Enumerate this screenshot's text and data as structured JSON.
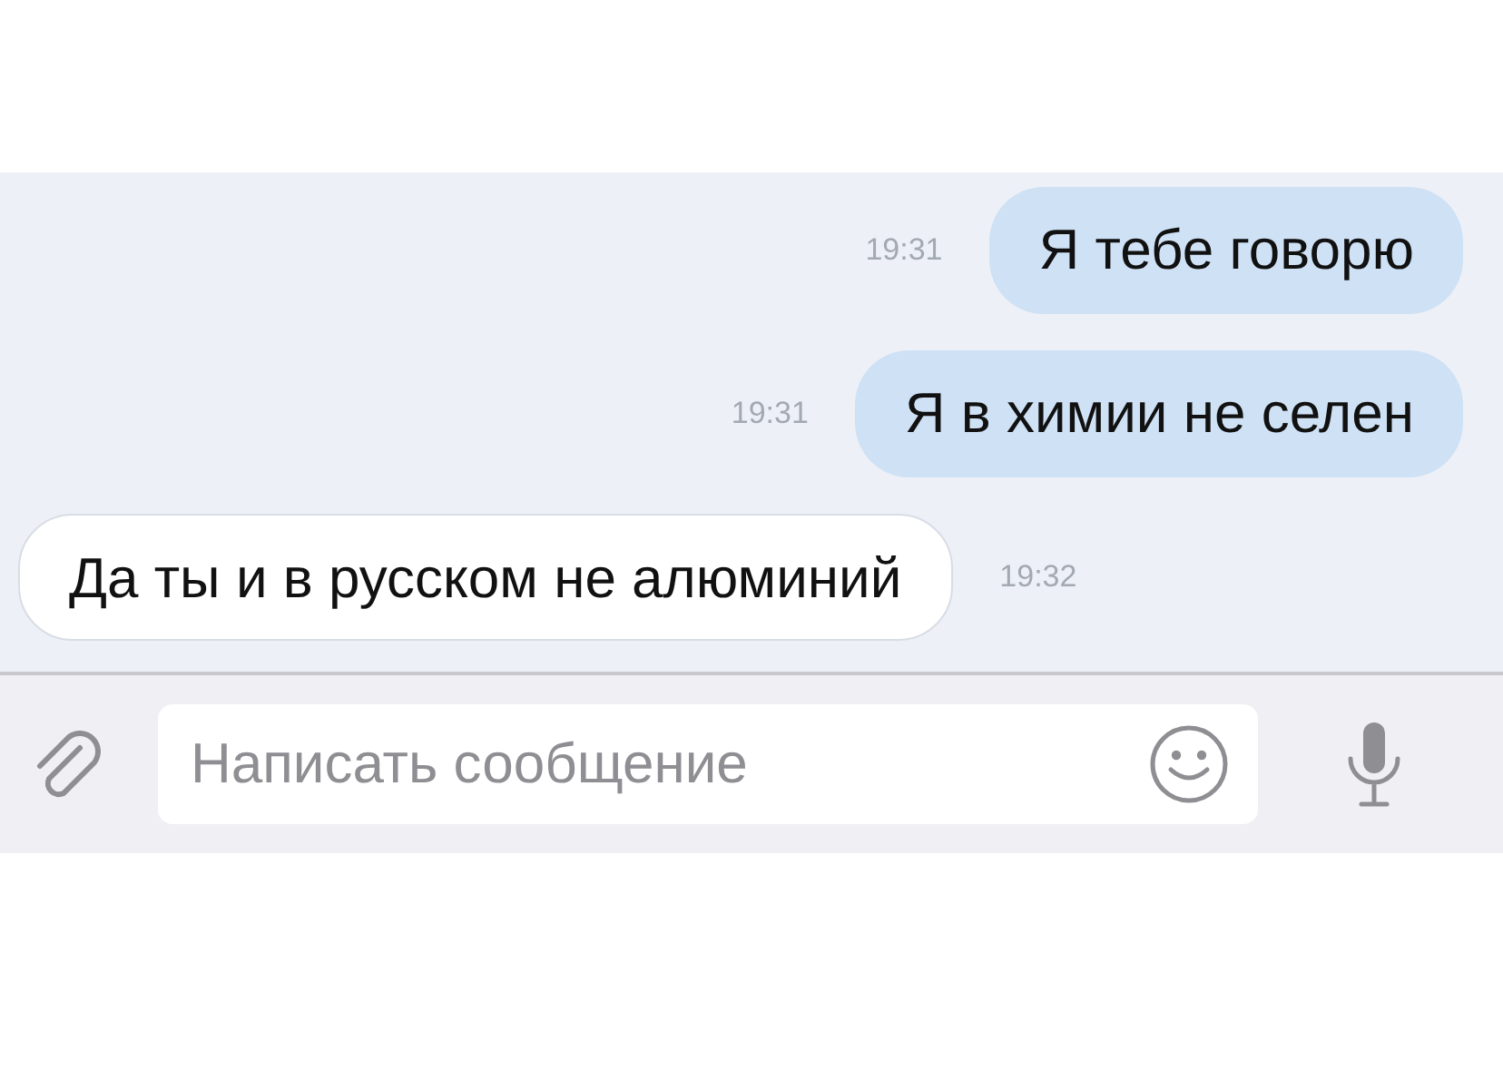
{
  "messages": [
    {
      "kind": "outgoing",
      "text": "Я тебе говорю",
      "time": "19:31"
    },
    {
      "kind": "outgoing",
      "text": "Я в химии не селен",
      "time": "19:31"
    },
    {
      "kind": "incoming",
      "text": "Да ты и в русском не алюминий",
      "time": "19:32"
    }
  ],
  "composer": {
    "placeholder": "Написать сообщение"
  }
}
